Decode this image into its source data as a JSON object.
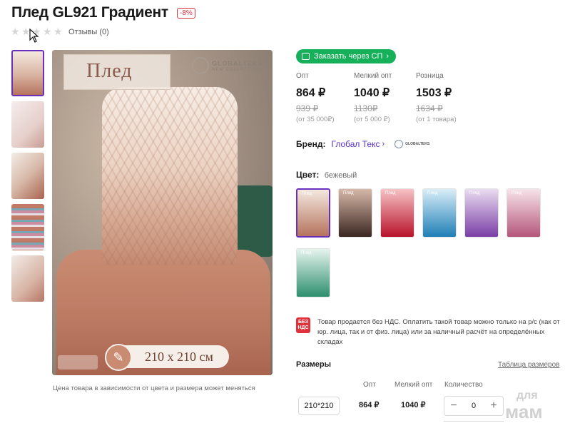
{
  "product": {
    "title": "Плед GL921 Градиент",
    "discount": "-8%",
    "reviews_label": "Отзывы (0)",
    "rating_stars": 0
  },
  "photo": {
    "heading": "Плед",
    "brand_name": "GLOBALTEKS",
    "brand_tagline": "NEW COLLECTION",
    "size_text": "210 х 210 см",
    "note": "Цена товара в зависимости от цвета и размера может меняться"
  },
  "order_button": {
    "label": "Заказать через СП"
  },
  "prices": [
    {
      "label": "Опт",
      "price": "864 ₽",
      "old": "939 ₽",
      "condition": "(от 35 000₽)"
    },
    {
      "label": "Мелкий опт",
      "price": "1040 ₽",
      "old": "1130₽",
      "condition": "(от 5 000 ₽)"
    },
    {
      "label": "Розница",
      "price": "1503 ₽",
      "old": "1634 ₽",
      "condition": "(от 1 товара)"
    }
  ],
  "brand": {
    "label": "Бренд:",
    "name": "Глобал Текс",
    "logo_text": "GLOBALTEKS"
  },
  "color": {
    "label": "Цвет:",
    "value": "бежевый",
    "swatch_tag": "Плед",
    "swatches": [
      {
        "name": "бежевый",
        "top": "#f4e8df",
        "bottom": "#b5735d"
      },
      {
        "name": "коричневый",
        "top": "#d7b8a8",
        "bottom": "#3a2620"
      },
      {
        "name": "красный",
        "top": "#f6c2c5",
        "bottom": "#b8132a"
      },
      {
        "name": "голубой",
        "top": "#d9eef8",
        "bottom": "#1f7fb6"
      },
      {
        "name": "сиреневый",
        "top": "#eadcf0",
        "bottom": "#7a3ea6"
      },
      {
        "name": "розовый",
        "top": "#f7e3ea",
        "bottom": "#b5577a"
      },
      {
        "name": "мятный",
        "top": "#e6f4ee",
        "bottom": "#2d8f6e"
      }
    ]
  },
  "nds": {
    "badge": "БЕЗ НДС",
    "text": "Товар продается без НДС. Оплатить такой товар можно только на р/с (как от юр. лица, так и от физ. лица) или за наличный расчёт на определённых складах"
  },
  "sizes": {
    "title": "Размеры",
    "table_link": "Таблица размеров",
    "headers": {
      "opt": "Опт",
      "small_opt": "Мелкий опт",
      "qty": "Количество"
    },
    "rows": [
      {
        "size": "210*210",
        "opt": "864 ₽",
        "small_opt": "1040 ₽",
        "qty": "0"
      }
    ]
  },
  "watermark": {
    "line1": "для",
    "line2": "мам"
  },
  "colors": {
    "accent": "#6b2fbf",
    "order_green": "#17b05a",
    "brand_link": "#5a32c8",
    "discount_red": "#e0323c"
  }
}
